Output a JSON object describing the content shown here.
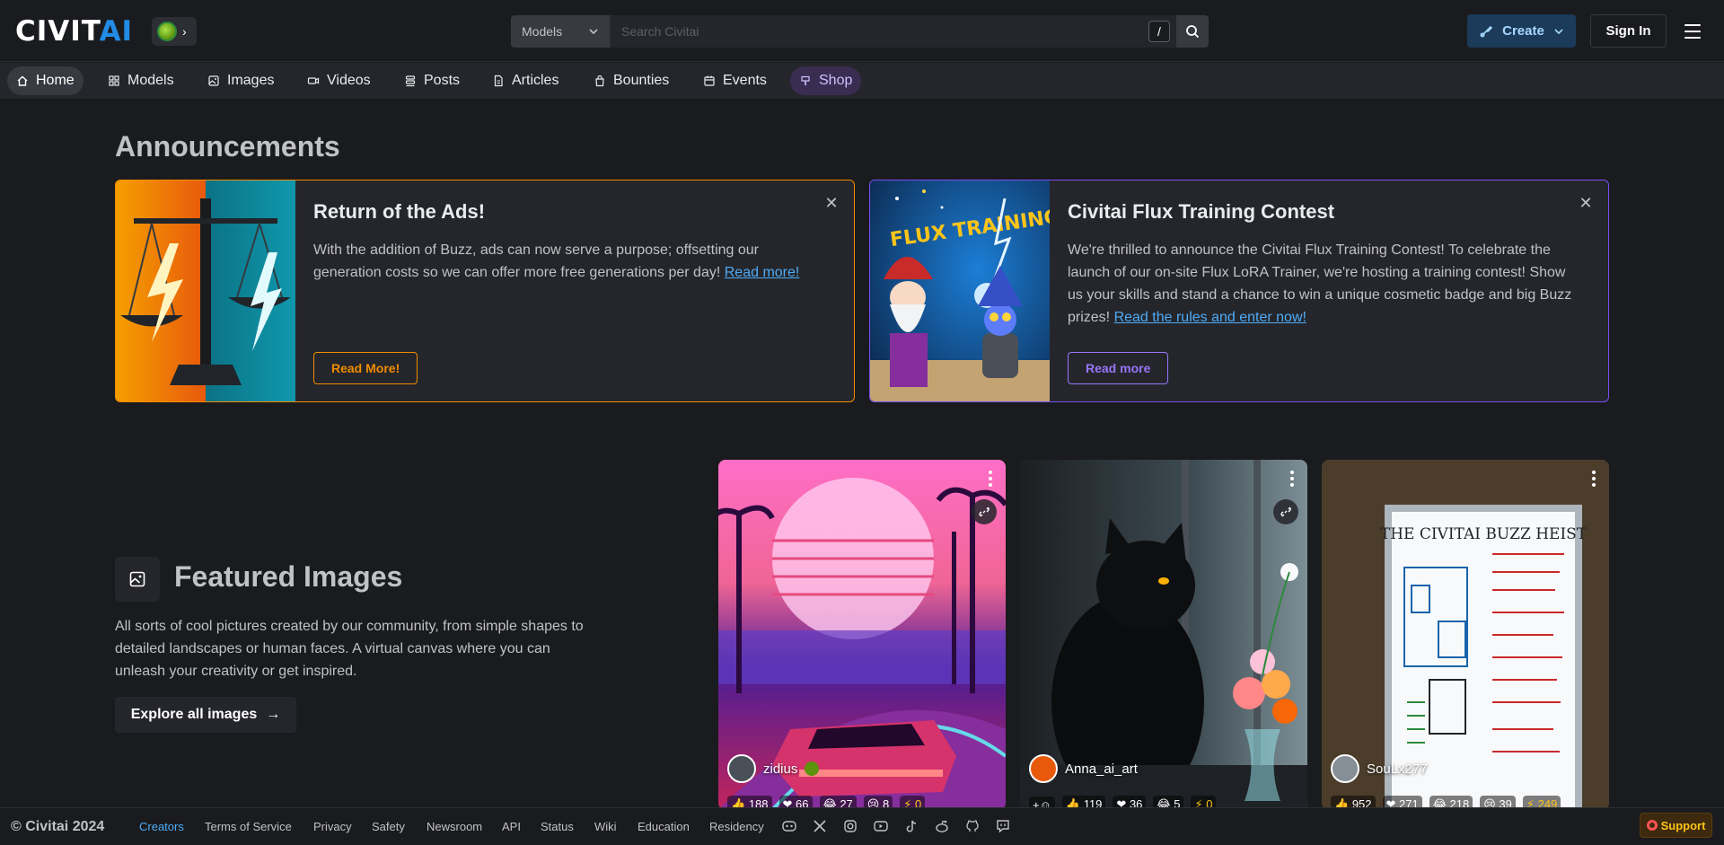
{
  "header": {
    "logo_main": "CIVIT",
    "logo_accent": "AI",
    "search_select": "Models",
    "search_placeholder": "Search Civitai",
    "search_shortcut": "/",
    "create_label": "Create",
    "signin_label": "Sign In"
  },
  "nav": {
    "items": [
      {
        "label": "Home",
        "icon": "home-icon"
      },
      {
        "label": "Models",
        "icon": "grid-icon"
      },
      {
        "label": "Images",
        "icon": "photo-icon"
      },
      {
        "label": "Videos",
        "icon": "video-icon"
      },
      {
        "label": "Posts",
        "icon": "layers-icon"
      },
      {
        "label": "Articles",
        "icon": "file-text-icon"
      },
      {
        "label": "Bounties",
        "icon": "bag-icon"
      },
      {
        "label": "Events",
        "icon": "calendar-icon"
      },
      {
        "label": "Shop",
        "icon": "paint-icon"
      }
    ]
  },
  "announcements": {
    "title": "Announcements",
    "cards": [
      {
        "title": "Return of the Ads!",
        "text": "With the addition of Buzz, ads can now serve a purpose; offsetting our generation costs so we can offer more free generations per day!",
        "link": "Read more!",
        "cta": "Read More!"
      },
      {
        "title": "Civitai Flux Training Contest",
        "text": "We're thrilled to announce the Civitai Flux Training Contest! To celebrate the launch of our on-site Flux LoRA Trainer, we're hosting a training contest! Show us your skills and stand a chance to win a unique cosmetic badge and big Buzz prizes!",
        "link": "Read the rules and enter now!",
        "cta": "Read more",
        "image_text": "FLUX TRAINING"
      }
    ]
  },
  "featured": {
    "title": "Featured Images",
    "description": "All sorts of cool pictures created by our community, from simple shapes to detailed landscapes or human faces. A virtual canvas where you can unleash your creativity or get inspired.",
    "explore_label": "Explore all images",
    "cards": [
      {
        "user": "zidius",
        "stats": [
          "188",
          "66",
          "27",
          "8",
          "0"
        ]
      },
      {
        "user": "Anna_ai_art",
        "stats": [
          "119",
          "36",
          "5",
          "0"
        ]
      },
      {
        "user": "SouLx277",
        "stats": [
          "952",
          "271",
          "218",
          "39",
          "249"
        ],
        "image_text": "THE CIVITAI BUZZ HEIST"
      }
    ]
  },
  "footer": {
    "copyright": "© Civitai 2024",
    "links": [
      "Creators",
      "Terms of Service",
      "Privacy",
      "Safety",
      "Newsroom",
      "API",
      "Status",
      "Wiki",
      "Education",
      "Residency"
    ],
    "support_label": "Support"
  },
  "colors": {
    "background": "#1a1b1e",
    "accent_blue": "#228be6",
    "ad_card_border": "#f08c00",
    "contest_card_border": "#7950f2",
    "support": "#fcc419"
  }
}
